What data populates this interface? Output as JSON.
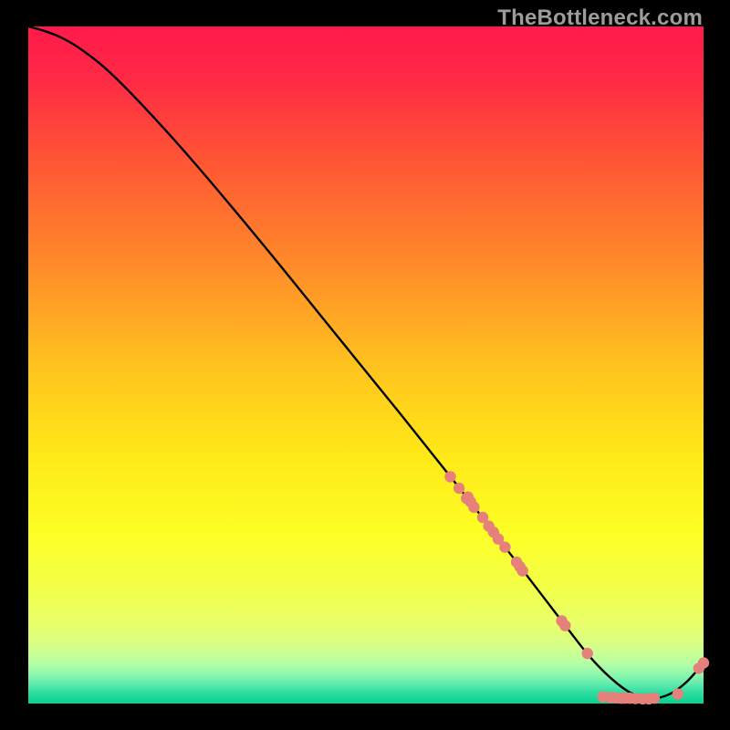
{
  "watermark": {
    "text": "TheBottleneck.com"
  },
  "chart_data": {
    "type": "line",
    "title": "",
    "xlabel": "",
    "ylabel": "",
    "xlim": [
      0,
      100
    ],
    "ylim": [
      0,
      100
    ],
    "gradient_stops": [
      {
        "offset": 0.0,
        "color": "#ff1a4b"
      },
      {
        "offset": 0.08,
        "color": "#ff2a45"
      },
      {
        "offset": 0.2,
        "color": "#ff5634"
      },
      {
        "offset": 0.35,
        "color": "#ff8a2a"
      },
      {
        "offset": 0.5,
        "color": "#ffc21f"
      },
      {
        "offset": 0.63,
        "color": "#ffe817"
      },
      {
        "offset": 0.75,
        "color": "#fdff25"
      },
      {
        "offset": 0.83,
        "color": "#f2ff4a"
      },
      {
        "offset": 0.885,
        "color": "#e7ff6b"
      },
      {
        "offset": 0.915,
        "color": "#d6ff88"
      },
      {
        "offset": 0.94,
        "color": "#b6ffa4"
      },
      {
        "offset": 0.958,
        "color": "#8bf8ae"
      },
      {
        "offset": 0.972,
        "color": "#5de9ad"
      },
      {
        "offset": 0.985,
        "color": "#2bdc9f"
      },
      {
        "offset": 1.0,
        "color": "#07d18e"
      }
    ],
    "series": [
      {
        "name": "bottleneck-curve",
        "color": "#000000",
        "x": [
          0,
          2.5,
          5,
          8,
          12,
          18,
          25,
          35,
          45,
          55,
          63,
          68,
          71,
          74,
          77,
          80,
          83,
          86,
          89,
          92,
          95,
          97.5,
          100
        ],
        "y": [
          100,
          99.3,
          98.3,
          96.5,
          93.3,
          87.2,
          79.4,
          67.5,
          55.2,
          42.9,
          32.9,
          26.5,
          22.6,
          18.7,
          14.8,
          10.9,
          7.1,
          4.0,
          1.7,
          0.7,
          1.4,
          3.2,
          6.0
        ]
      }
    ],
    "scatter": {
      "name": "sample-points",
      "color": "#e6807a",
      "radius": 6.2,
      "points": [
        {
          "x": 62.5,
          "y": 33.5
        },
        {
          "x": 63.8,
          "y": 31.8
        },
        {
          "x": 64.9,
          "y": 30.3
        },
        {
          "x": 65.1,
          "y": 30.5
        },
        {
          "x": 65.5,
          "y": 29.8
        },
        {
          "x": 66.0,
          "y": 29.0
        },
        {
          "x": 67.3,
          "y": 27.5
        },
        {
          "x": 68.2,
          "y": 26.2
        },
        {
          "x": 68.9,
          "y": 25.3
        },
        {
          "x": 69.6,
          "y": 24.3
        },
        {
          "x": 70.6,
          "y": 23.1
        },
        {
          "x": 72.3,
          "y": 20.9
        },
        {
          "x": 72.8,
          "y": 20.2
        },
        {
          "x": 73.2,
          "y": 19.6
        },
        {
          "x": 79.0,
          "y": 12.2
        },
        {
          "x": 79.5,
          "y": 11.5
        },
        {
          "x": 82.8,
          "y": 7.4
        },
        {
          "x": 85.1,
          "y": 1.0
        },
        {
          "x": 86.2,
          "y": 0.9
        },
        {
          "x": 87.0,
          "y": 0.85
        },
        {
          "x": 87.8,
          "y": 0.8
        },
        {
          "x": 88.3,
          "y": 0.8
        },
        {
          "x": 89.1,
          "y": 0.8
        },
        {
          "x": 89.9,
          "y": 0.75
        },
        {
          "x": 91.0,
          "y": 0.7
        },
        {
          "x": 91.9,
          "y": 0.7
        },
        {
          "x": 92.7,
          "y": 0.8
        },
        {
          "x": 96.2,
          "y": 1.4
        },
        {
          "x": 99.3,
          "y": 5.2
        },
        {
          "x": 100.0,
          "y": 6.0
        }
      ]
    }
  }
}
